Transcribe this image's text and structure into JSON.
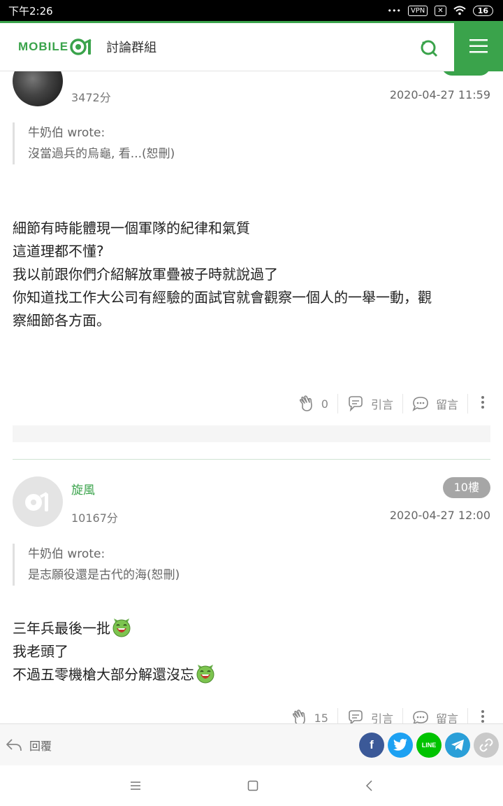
{
  "status_bar": {
    "time": "下午2:26",
    "vpn": "VPN",
    "battery": "16"
  },
  "header": {
    "logo_text": "MOBILE",
    "logo_suffix": "01",
    "title": "討論群組"
  },
  "posts": [
    {
      "username": "",
      "score": "3472分",
      "date": "2020-04-27 11:59",
      "quote_author": "牛奶伯 wrote:",
      "quote_text": "沒當過兵的烏龜, 看...(恕刪)",
      "body": [
        "細節有時能體現一個軍隊的紀律和氣質",
        "這道理都不懂?",
        "",
        "我以前跟你們介紹解放軍疊被子時就說過了",
        "",
        "你知道找工作大公司有經驗的面試官就會觀察一個人的一舉一動，觀",
        "察細節各方面。"
      ],
      "likes": "0",
      "quote_label": "引言",
      "comment_label": "留言"
    },
    {
      "username": "旋風",
      "floor": "10樓",
      "score": "10167分",
      "date": "2020-04-27 12:00",
      "quote_author": "牛奶伯 wrote:",
      "quote_text": "是志願役還是古代的海(恕刪)",
      "body": [
        "三年兵最後一批",
        "我老頭了",
        "不過五零機槍大部分解還沒忘"
      ],
      "likes": "15",
      "quote_label": "引言",
      "comment_label": "留言"
    }
  ],
  "bottom_bar": {
    "reply_label": "回覆",
    "line_label": "LINE",
    "facebook_label": "f"
  },
  "colors": {
    "brand_green": "#3aa34b",
    "facebook": "#3b5998",
    "twitter": "#1da1f2",
    "line": "#00c300",
    "telegram": "#2a9fd8",
    "link": "#c9c9c9"
  }
}
